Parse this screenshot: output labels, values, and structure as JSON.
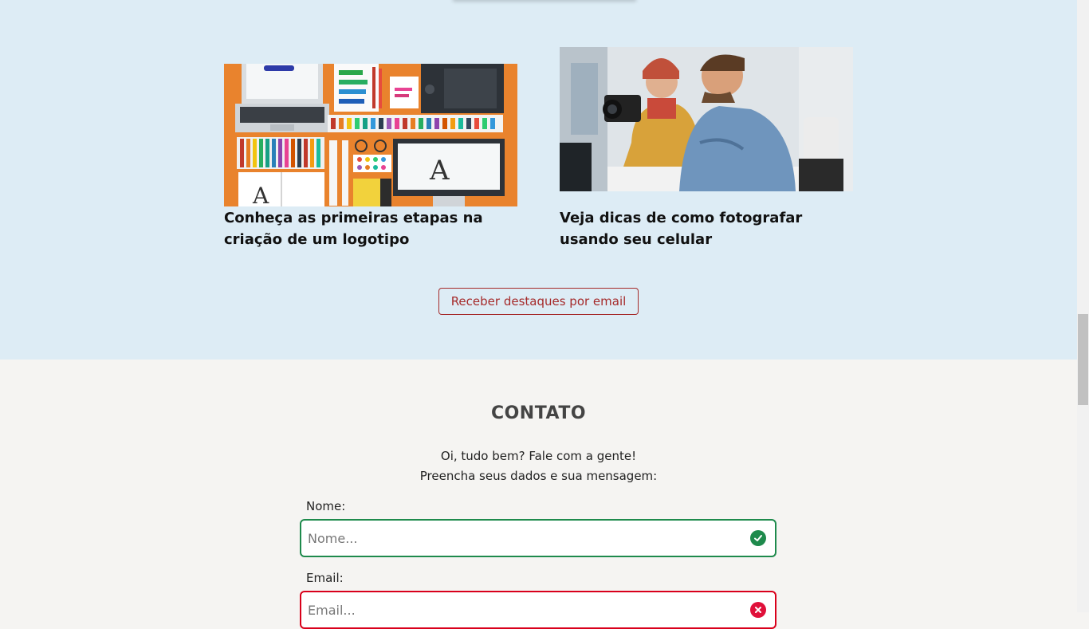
{
  "articles": [
    {
      "title": "Conheça as primeiras etapas na criação de um logotipo",
      "image": "design-tools-illustration"
    },
    {
      "title": "Veja dicas de como fotografar usando seu celular",
      "image": "photographers-photo"
    }
  ],
  "cta": {
    "label": "Receber destaques por email"
  },
  "contact": {
    "title": "CONTATO",
    "intro_line1": "Oi, tudo bem? Fale com a gente!",
    "intro_line2": "Preencha seus dados e sua mensagem:",
    "name_label": "Nome:",
    "name_placeholder": "Nome...",
    "name_status": "check-circle-icon",
    "email_label": "Email:",
    "email_placeholder": "Email...",
    "email_status": "x-circle-icon"
  },
  "colors": {
    "highlight_bg": "#ddecf5",
    "contact_bg": "#f5f4f2",
    "accent": "#a52a2a",
    "valid": "#1e8a4c",
    "invalid": "#e0103a"
  }
}
